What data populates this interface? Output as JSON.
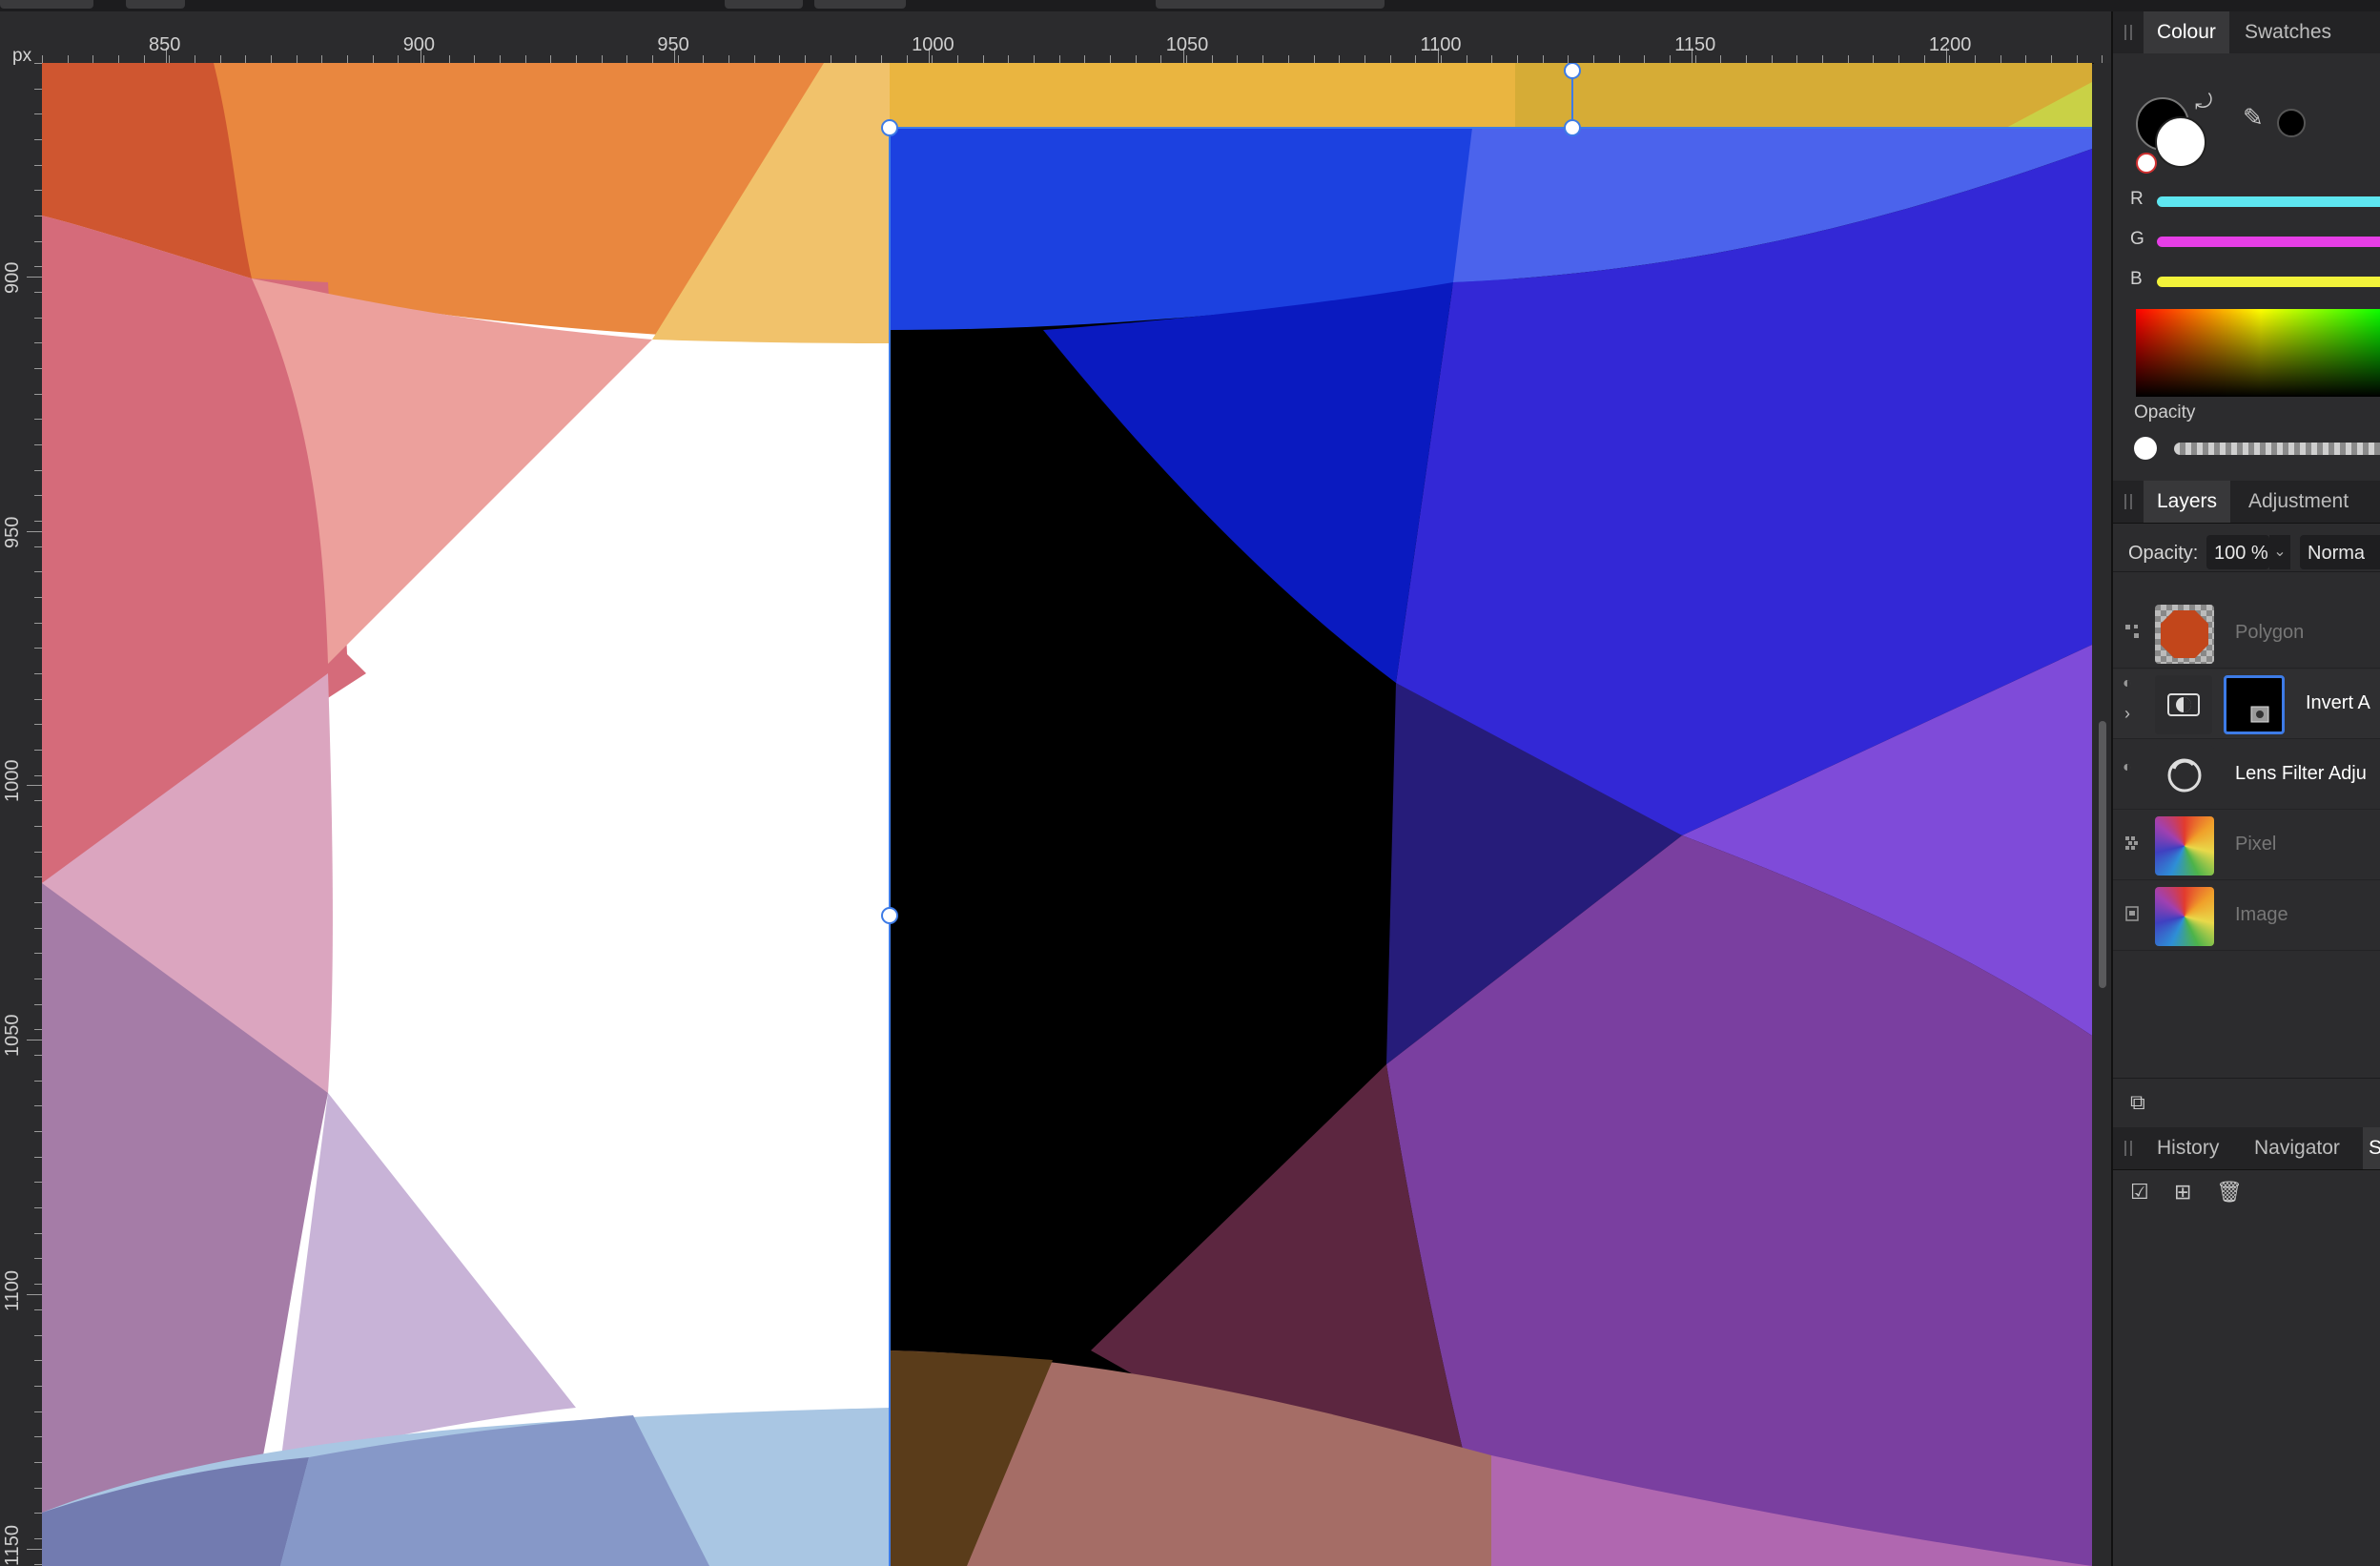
{
  "ruler": {
    "unit": "px",
    "h_labels": [
      "850",
      "900",
      "950",
      "1000",
      "1050",
      "1100",
      "1150",
      "1200"
    ],
    "v_labels": [
      "900",
      "950",
      "1000",
      "1050",
      "1100",
      "1150"
    ]
  },
  "colour_panel": {
    "tabs": [
      "Colour",
      "Swatches"
    ],
    "active_tab": "Colour",
    "channels": [
      {
        "label": "R",
        "color": "#5ee6f0"
      },
      {
        "label": "G",
        "color": "#e63ee6"
      },
      {
        "label": "B",
        "color": "#f2f23a"
      }
    ],
    "opacity_label": "Opacity",
    "primary_color": "#000000",
    "secondary_color": "#ffffff"
  },
  "layers_panel": {
    "tabs": [
      "Layers",
      "Adjustment"
    ],
    "active_tab": "Layers",
    "opacity_label": "Opacity:",
    "opacity_value": "100 %",
    "blend_mode": "Norma",
    "layers": [
      {
        "name": "Polygon",
        "dimmed": true,
        "kind": "polygon"
      },
      {
        "name": "Invert A",
        "dimmed": false,
        "kind": "invert",
        "selected": true
      },
      {
        "name": "Lens Filter Adju",
        "dimmed": false,
        "kind": "lens"
      },
      {
        "name": "Pixel",
        "dimmed": true,
        "kind": "pixel"
      },
      {
        "name": "Image",
        "dimmed": true,
        "kind": "image"
      }
    ]
  },
  "bottom_panel": {
    "tabs": [
      "History",
      "Navigator",
      "S"
    ],
    "active_tab": "S"
  }
}
